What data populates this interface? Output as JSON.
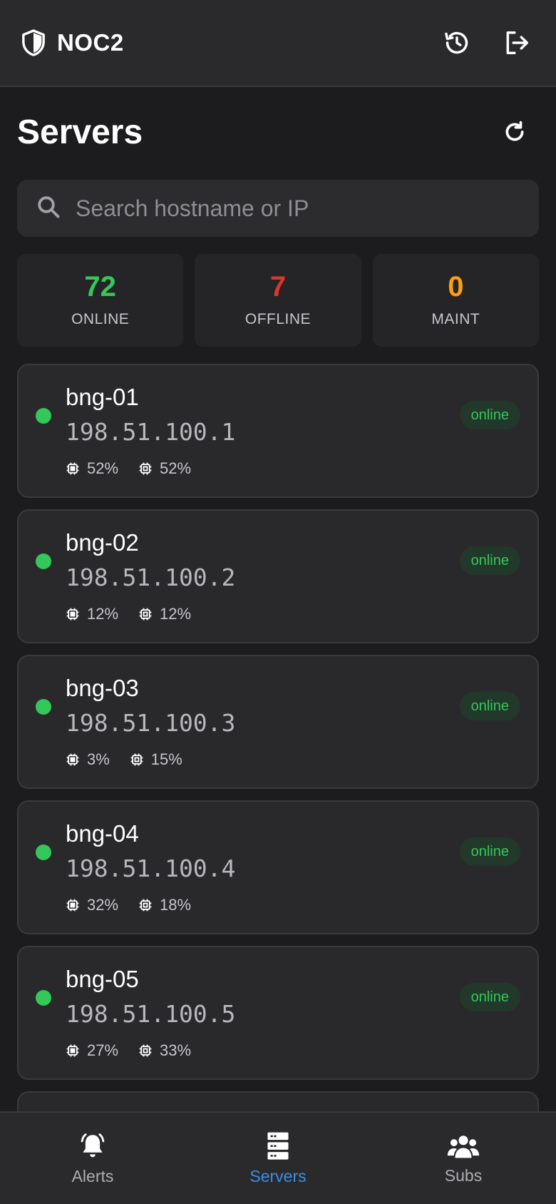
{
  "app": {
    "title": "NOC2",
    "icons": {
      "brand": "shield-icon",
      "history": "history-icon",
      "logout": "logout-icon"
    }
  },
  "page": {
    "title": "Servers",
    "refresh_icon": "refresh-icon"
  },
  "search": {
    "placeholder": "Search hostname or IP",
    "value": "",
    "icon": "search-icon"
  },
  "stats": {
    "online": {
      "value": "72",
      "label": "ONLINE",
      "color": "#34c759"
    },
    "offline": {
      "value": "7",
      "label": "OFFLINE",
      "color": "#e0342c"
    },
    "maint": {
      "value": "0",
      "label": "MAINT",
      "color": "#ff9f0a"
    }
  },
  "servers": [
    {
      "host": "bng-01",
      "ip": "198.51.100.1",
      "cpu": "52%",
      "mem": "52%",
      "status": "online"
    },
    {
      "host": "bng-02",
      "ip": "198.51.100.2",
      "cpu": "12%",
      "mem": "12%",
      "status": "online"
    },
    {
      "host": "bng-03",
      "ip": "198.51.100.3",
      "cpu": "3%",
      "mem": "15%",
      "status": "online"
    },
    {
      "host": "bng-04",
      "ip": "198.51.100.4",
      "cpu": "32%",
      "mem": "18%",
      "status": "online"
    },
    {
      "host": "bng-05",
      "ip": "198.51.100.5",
      "cpu": "27%",
      "mem": "33%",
      "status": "online"
    }
  ],
  "colors": {
    "online": "#34c759",
    "accent": "#3a8ee6"
  },
  "nav": {
    "items": [
      {
        "label": "Alerts",
        "icon": "bell-icon",
        "active": false
      },
      {
        "label": "Servers",
        "icon": "server-icon",
        "active": true
      },
      {
        "label": "Subs",
        "icon": "users-icon",
        "active": false
      }
    ]
  }
}
